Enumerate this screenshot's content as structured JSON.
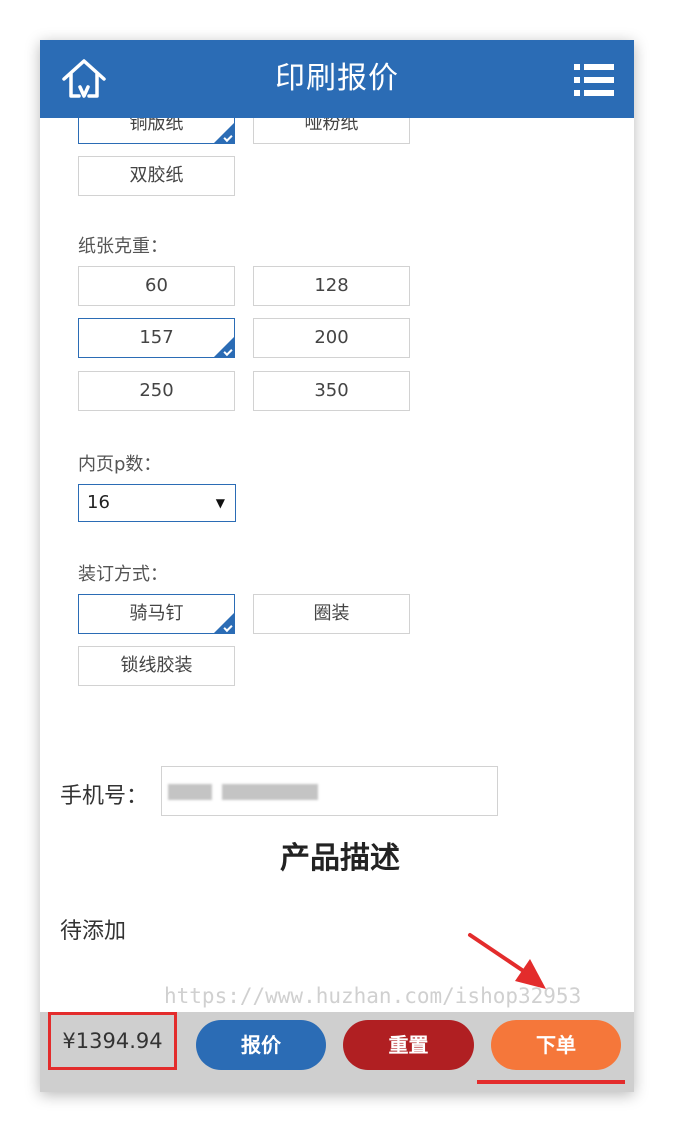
{
  "header": {
    "title": "印刷报价",
    "home_icon": "home-icon",
    "menu_icon": "menu-icon"
  },
  "paper_types": {
    "items": [
      "铜版纸",
      "哑粉纸",
      "双胶纸"
    ],
    "selected": "铜版纸"
  },
  "paper_weight": {
    "label": "纸张克重：",
    "items": [
      "60",
      "128",
      "157",
      "200",
      "250",
      "350"
    ],
    "selected": "157"
  },
  "inner_pages": {
    "label": "内页p数：",
    "value": "16"
  },
  "binding": {
    "label": "装订方式：",
    "items": [
      "骑马钉",
      "圈装",
      "锁线胶装"
    ],
    "selected": "骑马钉"
  },
  "phone": {
    "label": "手机号：",
    "value": ""
  },
  "description": {
    "title": "产品描述",
    "body": "待添加"
  },
  "watermark": "https://www.huzhan.com/ishop32953",
  "footer": {
    "price": "¥1394.94",
    "quote_label": "报价",
    "reset_label": "重置",
    "order_label": "下单"
  },
  "colors": {
    "brand": "#2b6cb5",
    "reset": "#b01f22",
    "order": "#f5773a",
    "highlight": "#e32c2c"
  }
}
